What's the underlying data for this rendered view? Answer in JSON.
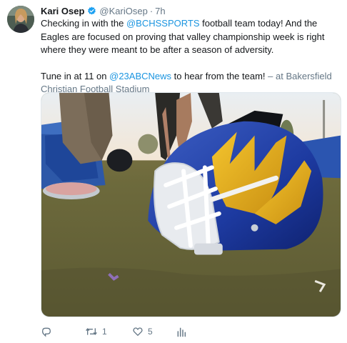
{
  "tweet": {
    "display_name": "Kari Osep",
    "handle": "@KariOsep",
    "separator": "·",
    "time": "7h",
    "line1_pre": "Checking in with the ",
    "mention_bchs": "@BCHSSPORTS",
    "line1_post": " football team today! And the Eagles are focused on proving that valley championship week is right where they were meant to be after a season of adversity.",
    "line2_pre": "Tune in at 11 on ",
    "mention_abc": "@23ABCNews",
    "line2_post": " to hear from the team! ",
    "location": "– at Bakersfield Christian Football Stadium",
    "media_icon": "football-helmet-photo"
  },
  "actions": {
    "reply_icon": "reply-icon",
    "retweet_icon": "retweet-icon",
    "retweet_count": "1",
    "like_icon": "heart-icon",
    "like_count": "5",
    "analytics_icon": "analytics-icon"
  },
  "colors": {
    "link": "#1b95e0",
    "verified": "#1da1f2",
    "muted": "#657786",
    "text": "#14171a"
  }
}
